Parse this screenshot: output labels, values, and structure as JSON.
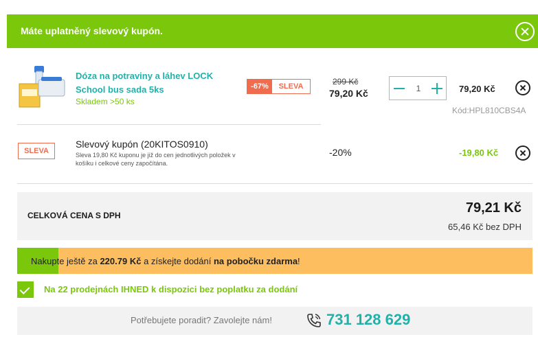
{
  "notice": {
    "text": "Máte uplatněný slevový kupón."
  },
  "product": {
    "name": "Dóza na potraviny a láhev LOCK School bus sada 5ks",
    "stock": "Skladem >50 ks",
    "discount_pct": "-67%",
    "discount_label": "SLEVA",
    "price_old": "299 Kč",
    "price_new": "79,20 Kč",
    "quantity": "1",
    "total": "79,20 Kč",
    "code": "Kód:HPL810CBS4A"
  },
  "coupon": {
    "tag": "SLEVA",
    "title": "Slevový kupón (20KITOS0910)",
    "description": "Sleva 19,80 Kč kuponu je již do cen jednotlivých položek v košíku i celkové ceny započítána.",
    "percent": "-20%",
    "total": "-19,80 Kč"
  },
  "summary": {
    "label": "CELKOVÁ CENA S DPH",
    "price": "79,21 Kč",
    "net": "65,46 Kč bez DPH"
  },
  "shipping": {
    "text_1": "Nakupte ještě za ",
    "amount": "220.79 Kč",
    "text_2": " a získejte dodání ",
    "target": "na pobočku zdarma",
    "text_3": "!",
    "progress": 0.08
  },
  "stores": {
    "text": "Na 22 prodejnách IHNED k dispozici bez poplatku za dodání"
  },
  "help": {
    "text": "Potřebujete poradit? Zavolejte nám!",
    "phone": "731 128 629"
  },
  "colors": {
    "green": "#7ac70c",
    "teal": "#20b2aa",
    "sale": "#ef6c4f",
    "orange": "#fdbe5f"
  }
}
